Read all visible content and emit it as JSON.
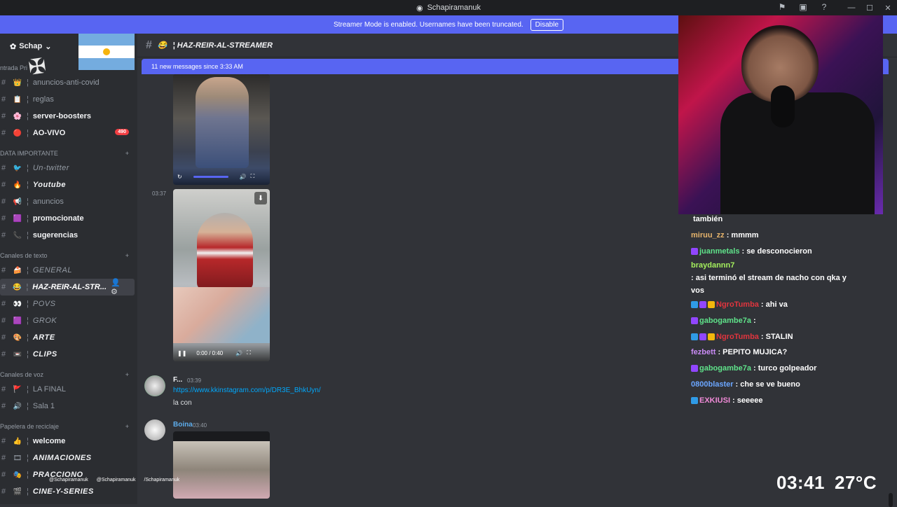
{
  "window": {
    "title": "Schapiramanuk"
  },
  "streamer_bar": {
    "text": "Streamer Mode is enabled. Usernames have been truncated.",
    "disable_label": "Disable"
  },
  "server": {
    "name": "Schap",
    "caret": "⌄"
  },
  "sidebar": {
    "truncated_category": "ntrada Pri",
    "channels_top": [
      {
        "label": "anuncios-anti-covid",
        "emoji": "👑",
        "style": "muted"
      },
      {
        "label": "reglas",
        "emoji": "📋",
        "style": "muted"
      },
      {
        "label": "server-boosters",
        "emoji": "🌸",
        "style": "bold"
      },
      {
        "label": "AO-VIVO",
        "emoji": "🔴",
        "style": "bold",
        "badge": "490"
      }
    ],
    "cat_importante": "DATA IMPORTANTE",
    "channels_importante": [
      {
        "label": "Un-twitter",
        "emoji": "🐦",
        "style": "ital"
      },
      {
        "label": "Youtube",
        "emoji": "🔥",
        "style": "bolditalic"
      },
      {
        "label": "anuncios",
        "emoji": "📢",
        "style": "muted"
      },
      {
        "label": "promocionate",
        "emoji": "🟪",
        "style": "bold"
      },
      {
        "label": "sugerencias",
        "emoji": "📞",
        "style": "bold"
      }
    ],
    "cat_texto": "Canales de texto",
    "channels_texto": [
      {
        "label": "GENERAL",
        "emoji": "🍰",
        "style": "ital"
      },
      {
        "label": "HAZ-REIR-AL-STR...",
        "emoji": "😂",
        "style": "active"
      },
      {
        "label": "POVS",
        "emoji": "👀",
        "style": "ital"
      },
      {
        "label": "GROK",
        "emoji": "🟪",
        "style": "ital"
      },
      {
        "label": "ARTE",
        "emoji": "🎨",
        "style": "bolditalic"
      },
      {
        "label": "CLIPS",
        "emoji": "📼",
        "style": "bolditalic"
      }
    ],
    "cat_voz": "Canales de voz",
    "channels_voz": [
      {
        "label": "LA FINAL",
        "emoji": "🚩",
        "style": "muted"
      },
      {
        "label": "Sala 1",
        "emoji": "🔊",
        "style": "muted"
      }
    ],
    "cat_reciclaje": "Papelera de reciclaje",
    "channels_reciclaje": [
      {
        "label": "welcome",
        "emoji": "👍",
        "style": "bold"
      },
      {
        "label": "ANIMACIONES",
        "emoji": "🎞",
        "style": "bolditalic"
      },
      {
        "label": "PRACCIONO",
        "emoji": "🎭",
        "style": "bolditalic"
      },
      {
        "label": "CINE-Y-SERIES",
        "emoji": "🎬",
        "style": "bolditalic"
      }
    ]
  },
  "channel_header": {
    "emoji": "😂",
    "name": "¦ HAZ-REIR-AL-STREAMER"
  },
  "new_messages": {
    "text": "11 new messages since 3:33 AM"
  },
  "messages": {
    "video1_time": "",
    "video2_ts": "03:37",
    "video2_time": "0:00 / 0:40",
    "msg1": {
      "author": "F...",
      "time": "03:39",
      "link": "https://www.kkinstagram.com/p/DR3E_BhkUyn/",
      "text": "la con"
    },
    "msg2": {
      "author": "Boina",
      "time": "03:40"
    }
  },
  "chat": [
    {
      "user": "",
      "text": "también",
      "color": "#ffffff",
      "icons": []
    },
    {
      "user": "miruu_zz",
      "text": ": mmmm",
      "color": "#e6b46c",
      "icons": []
    },
    {
      "user": "juanmetals",
      "text": ": se desconocieron",
      "color": "#5fe38a",
      "icons": [
        "#9146ff"
      ]
    },
    {
      "user": "braydannn7",
      "text": ": asi terminó el stream de nacho con qka y vos",
      "color": "#a4ef5d",
      "icons": []
    },
    {
      "user": "NgroTumba",
      "text": ": ahi va",
      "color": "#e0353e",
      "icons": [
        "#2f9be6",
        "#9146ff",
        "#f2b70c"
      ]
    },
    {
      "user": "gabogambe7a",
      "text": ":",
      "color": "#5fe38a",
      "icons": [
        "#9146ff"
      ]
    },
    {
      "user": "NgroTumba",
      "text": ": STALIN",
      "color": "#e0353e",
      "icons": [
        "#2f9be6",
        "#9146ff",
        "#f2b70c"
      ]
    },
    {
      "user": "fezbett",
      "text": ": PEPITO MUJICA?",
      "color": "#c98bf5",
      "icons": []
    },
    {
      "user": "gabogambe7a",
      "text": ": turco golpeador",
      "color": "#5fe38a",
      "icons": [
        "#9146ff"
      ]
    },
    {
      "user": "0800blaster",
      "text": ": che se ve bueno",
      "color": "#6ba6ff",
      "icons": []
    },
    {
      "user": "EXKIUSI",
      "text": ": seeeee",
      "color": "#f08ad7",
      "icons": [
        "#2f9be6"
      ]
    }
  ],
  "overlay": {
    "time": "03:41",
    "temp": "27°C",
    "socials": [
      "@Schapiramanuk",
      "@Schapiramanuk",
      "/Schapiramanuk"
    ]
  }
}
